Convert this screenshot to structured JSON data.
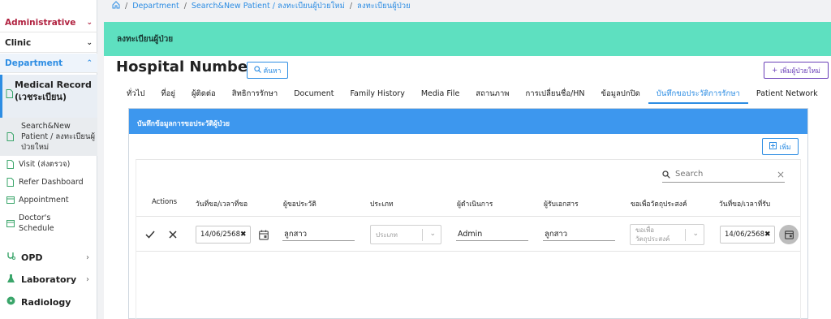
{
  "sidebar": {
    "administrative": "Administrative",
    "clinic": "Clinic",
    "department": "Department",
    "medical_record": "Medical Record (เวชระเบียน)",
    "search_new": "Search&New Patient / ลงทะเบียนผู้ป่วยใหม่",
    "visit": "Visit (ส่งตรวจ)",
    "refer": "Refer Dashboard",
    "appointment": "Appointment",
    "doctor_schedule": "Doctor's Schedule",
    "opd": "OPD",
    "laboratory": "Laboratory",
    "radiology": "Radiology"
  },
  "breadcrumb": {
    "home_icon": "home-icon",
    "department": "Department",
    "search_new": "Search&New Patient / ลงทะเบียนผู้ป่วยใหม่",
    "current": "ลงทะเบียนผู้ป่วย"
  },
  "header": {
    "band_title": "ลงทะเบียนผู้ป่วย",
    "title": "Hospital Number",
    "search_button": "ค้นหา",
    "add_patient_button": "เพิ่มผู้ป่วยใหม่"
  },
  "tabs": [
    "ทั่วไป",
    "ที่อยู่",
    "ผู้ติดต่อ",
    "สิทธิการรักษา",
    "Document",
    "Family History",
    "Media File",
    "สถานภาพ",
    "การเปลี่ยนชื่อ/HN",
    "ข้อมูลปกปิด",
    "บันทึกขอประวัติการรักษา",
    "Patient Network"
  ],
  "active_tab_index": 10,
  "card": {
    "title": "บันทึกข้อมูลการขอประวัติผู้ป่วย",
    "add_button": "เพิ่ม",
    "search_placeholder": "Search",
    "columns": [
      "Actions",
      "วันที่ขอ/เวลาที่ขอ",
      "ผู้ขอประวัติ",
      "ประเภท",
      "ผู้ดำเนินการ",
      "ผู้รับเอกสาร",
      "ขอเพื่อวัตถุประสงค์",
      "วันที่ขอ/เวลาที่รับ"
    ],
    "row": {
      "request_date": "14/06/2568",
      "requester": "ลูกสาว",
      "type_placeholder": "ประเภท",
      "operator": "Admin",
      "receiver": "ลูกสาว",
      "purpose_placeholder": "ขอเพื่อวัตถุประสงค์",
      "receive_date": "14/06/2568"
    }
  },
  "colors": {
    "accent": "#2d8de3",
    "band": "#5ee0c0",
    "card_header": "#3d97ee",
    "admin_red": "#b0213f",
    "purple": "#6a3fb8"
  }
}
